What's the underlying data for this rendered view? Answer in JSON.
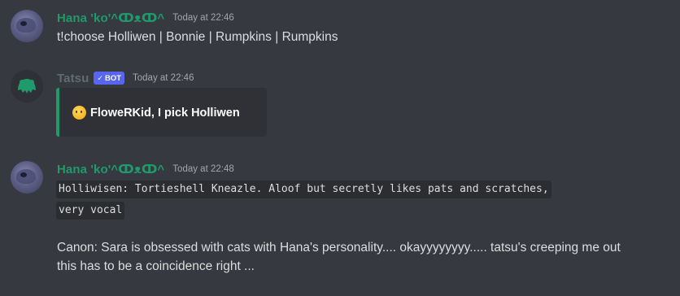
{
  "messages": [
    {
      "author": "Hana 'ko'^ↀᴥↀ^",
      "timestamp": "Today at 22:46",
      "text": "t!choose Holliwen | Bonnie | Rumpkins | Rumpkins"
    },
    {
      "author": "Tatsu",
      "bot_tag": "BOT",
      "timestamp": "Today at 22:46",
      "embed": {
        "emoji": "thinking-face-emoji",
        "text": "FloweRKid, I pick Holliwen"
      }
    },
    {
      "author": "Hana 'ko'^ↀᴥↀ^",
      "timestamp": "Today at 22:48",
      "code_lines": [
        "Holliwisen: Tortieshell Kneazle. Aloof but secretly likes pats and scratches,",
        "very vocal"
      ],
      "lines": [
        "Canon: Sara is obsessed with cats with Hana's personality.... okayyyyyyyy..... tatsu's creeping me out",
        "this has to be a coincidence right ..."
      ]
    }
  ],
  "colors": {
    "background": "#36393f",
    "hana_name": "#1f9a6b",
    "tatsu_name": "#5e6d74",
    "bot_tag": "#5865f2",
    "embed_bg": "#2f3136",
    "embed_border": "#1f9a6b"
  }
}
